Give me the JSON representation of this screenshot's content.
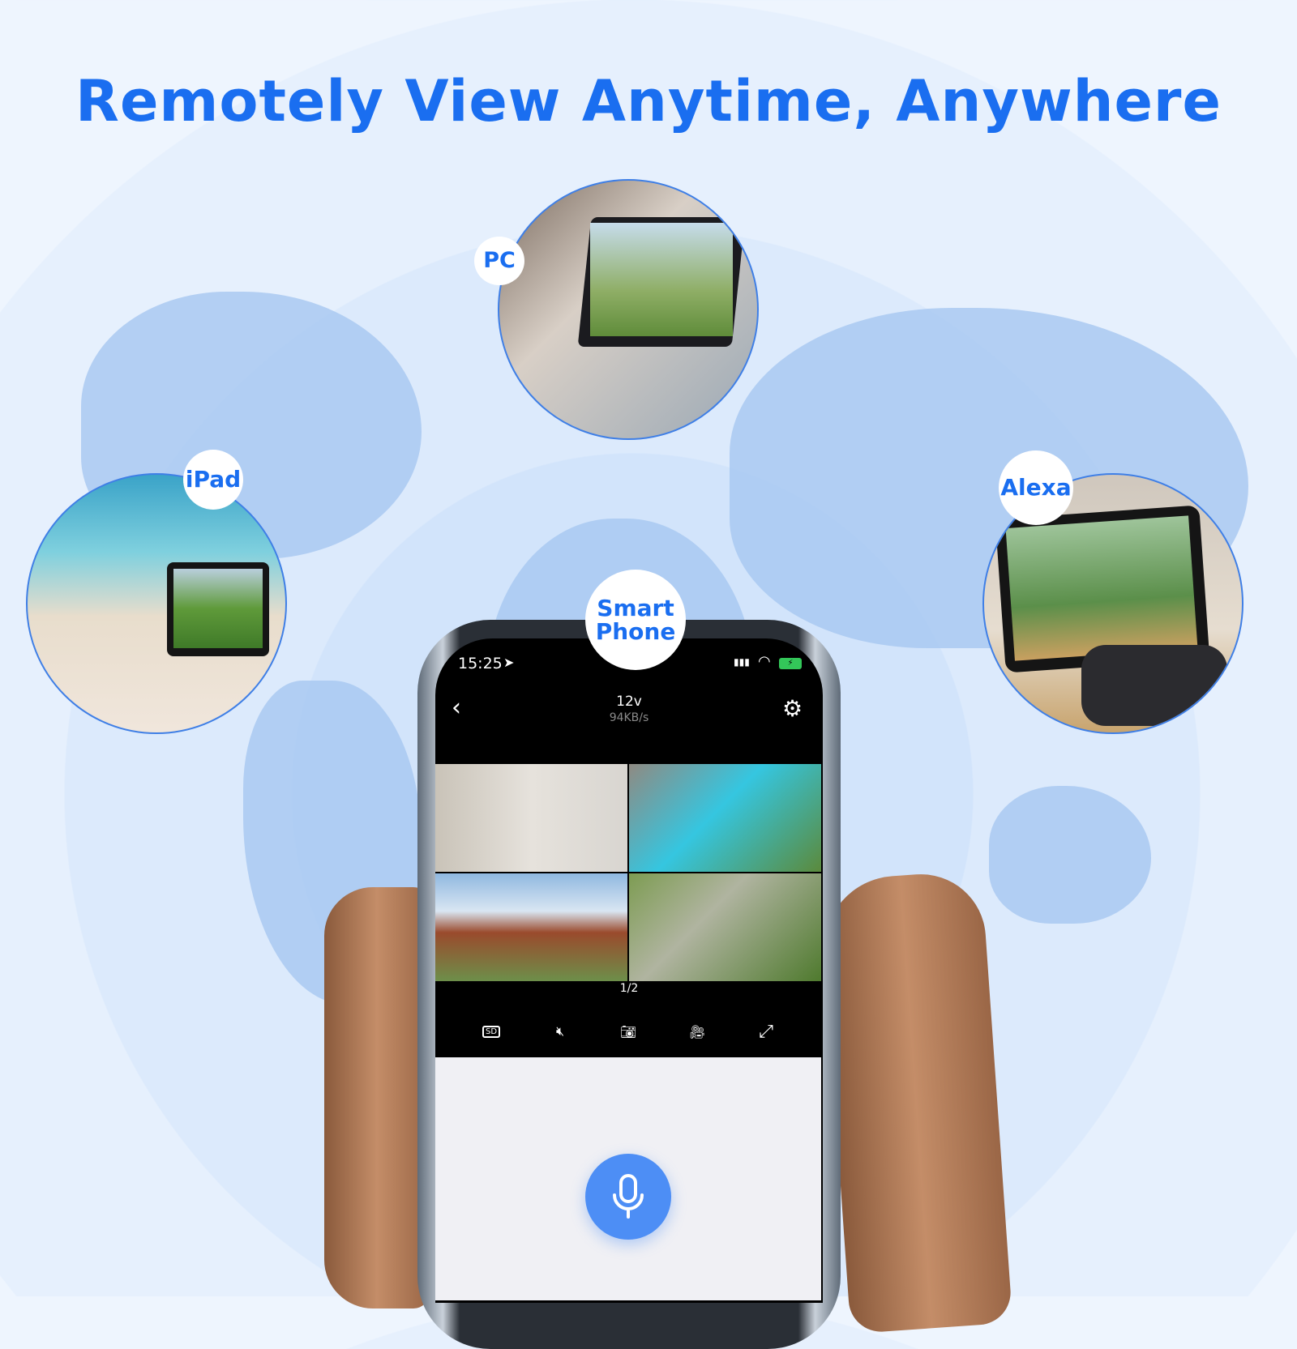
{
  "headline": "Remotely View Anytime, Anywhere",
  "devices": {
    "pc": "PC",
    "ipad": "iPad",
    "alexa": "Alexa",
    "phone_line1": "Smart",
    "phone_line2": "Phone"
  },
  "phone": {
    "status": {
      "time": "15:25",
      "icons": [
        "location-arrow-icon",
        "signal-icon",
        "wifi-icon",
        "battery-charging-icon"
      ]
    },
    "header": {
      "title": "12v",
      "subtitle": "94KB/s"
    },
    "page_indicator": "1/2",
    "toolbar": [
      "sd-quality-icon",
      "mute-icon",
      "snapshot-camera-icon",
      "record-video-icon",
      "fullscreen-icon"
    ],
    "mic_color": "#4d8ef5"
  },
  "colors": {
    "accent": "#1a6ef0",
    "map": "#a9c9f1"
  }
}
